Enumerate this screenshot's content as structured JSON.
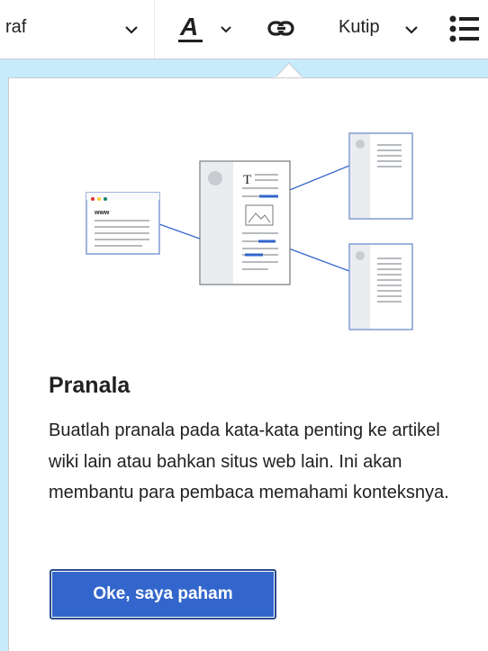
{
  "toolbar": {
    "paragraph_label": "raf",
    "text_style_letter": "A",
    "quote_label": "Kutip"
  },
  "illustration": {
    "browser_url_text": "www",
    "doc_heading_letter": "T"
  },
  "popup": {
    "title": "Pranala",
    "description": "Buatlah pranala pada kata-kata penting ke artikel wiki lain atau bahkan situs web lain. Ini akan membantu para pembaca memahami konteksnya.",
    "button_label": "Oke, saya paham"
  },
  "colors": {
    "background": "#c7ebfb",
    "accent": "#3366cc",
    "text": "#202122"
  }
}
